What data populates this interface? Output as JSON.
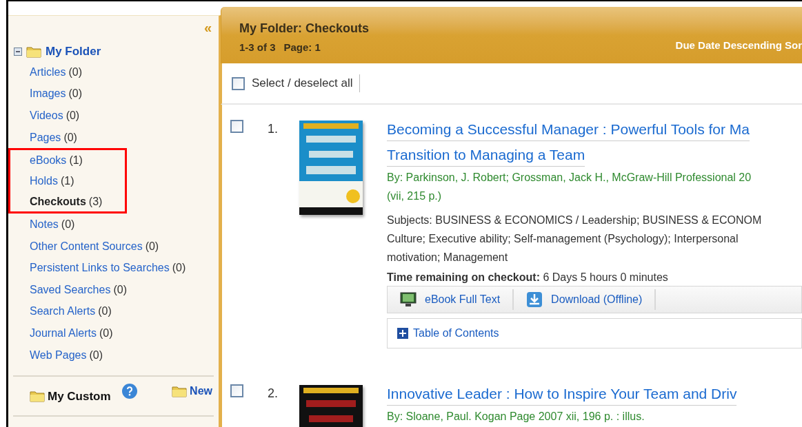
{
  "sidebar": {
    "collapse": "«",
    "folder": {
      "label": "My Folder",
      "expanded": true
    },
    "items": [
      {
        "label": "Articles",
        "count": "(0)",
        "selected": false,
        "highlighted": false
      },
      {
        "label": "Images",
        "count": "(0)",
        "selected": false,
        "highlighted": false
      },
      {
        "label": "Videos",
        "count": "(0)",
        "selected": false,
        "highlighted": false
      },
      {
        "label": "Pages",
        "count": "(0)",
        "selected": false,
        "highlighted": false
      },
      {
        "label": "eBooks",
        "count": "(1)",
        "selected": false,
        "highlighted": true
      },
      {
        "label": "Holds",
        "count": "(1)",
        "selected": false,
        "highlighted": true
      },
      {
        "label": "Checkouts",
        "count": "(3)",
        "selected": true,
        "highlighted": true
      },
      {
        "label": "Notes",
        "count": "(0)",
        "selected": false,
        "highlighted": false
      },
      {
        "label": "Other Content Sources",
        "count": "(0)",
        "selected": false,
        "highlighted": false
      },
      {
        "label": "Persistent Links to Searches",
        "count": "(0)",
        "selected": false,
        "highlighted": false
      },
      {
        "label": "Saved Searches",
        "count": "(0)",
        "selected": false,
        "highlighted": false
      },
      {
        "label": "Search Alerts",
        "count": "(0)",
        "selected": false,
        "highlighted": false
      },
      {
        "label": "Journal Alerts",
        "count": "(0)",
        "selected": false,
        "highlighted": false
      },
      {
        "label": "Web Pages",
        "count": "(0)",
        "selected": false,
        "highlighted": false
      }
    ],
    "custom": {
      "label": "My Custom",
      "new_label": "New"
    }
  },
  "header": {
    "title": "My Folder: Checkouts",
    "range": "1-3 of 3",
    "page": "Page: 1",
    "sort": "Due Date Descending Sor"
  },
  "toolbar": {
    "select_all": {
      "label": "Select / deselect all",
      "checked": false
    }
  },
  "results": [
    {
      "number": "1.",
      "checked": false,
      "title_lines": [
        "Becoming a Successful Manager : Powerful Tools for Ma",
        "Transition to Managing a Team"
      ],
      "byline": [
        "By: Parkinson, J. Robert; Grossman, Jack H., McGraw-Hill Professional 20",
        "(vii, 215 p.)"
      ],
      "subjects": [
        "Subjects: BUSINESS & ECONOMICS / Leadership; BUSINESS & ECONOM",
        "Culture; Executive ability; Self-management (Psychology); Interpersonal",
        "motivation; Management"
      ],
      "time_label": "Time remaining on checkout:",
      "time_value": "6 Days 5 hours 0 minutes",
      "actions": [
        {
          "kind": "ebook",
          "label": "eBook Full Text"
        },
        {
          "kind": "download",
          "label": "Download (Offline)"
        }
      ],
      "toc": "Table of Contents"
    },
    {
      "number": "2.",
      "checked": false,
      "title_lines": [
        "Innovative Leader : How to Inspire Your Team and Driv"
      ],
      "byline": [
        "By: Sloane, Paul. Kogan Page 2007 xii, 196 p. : illus."
      ]
    }
  ]
}
